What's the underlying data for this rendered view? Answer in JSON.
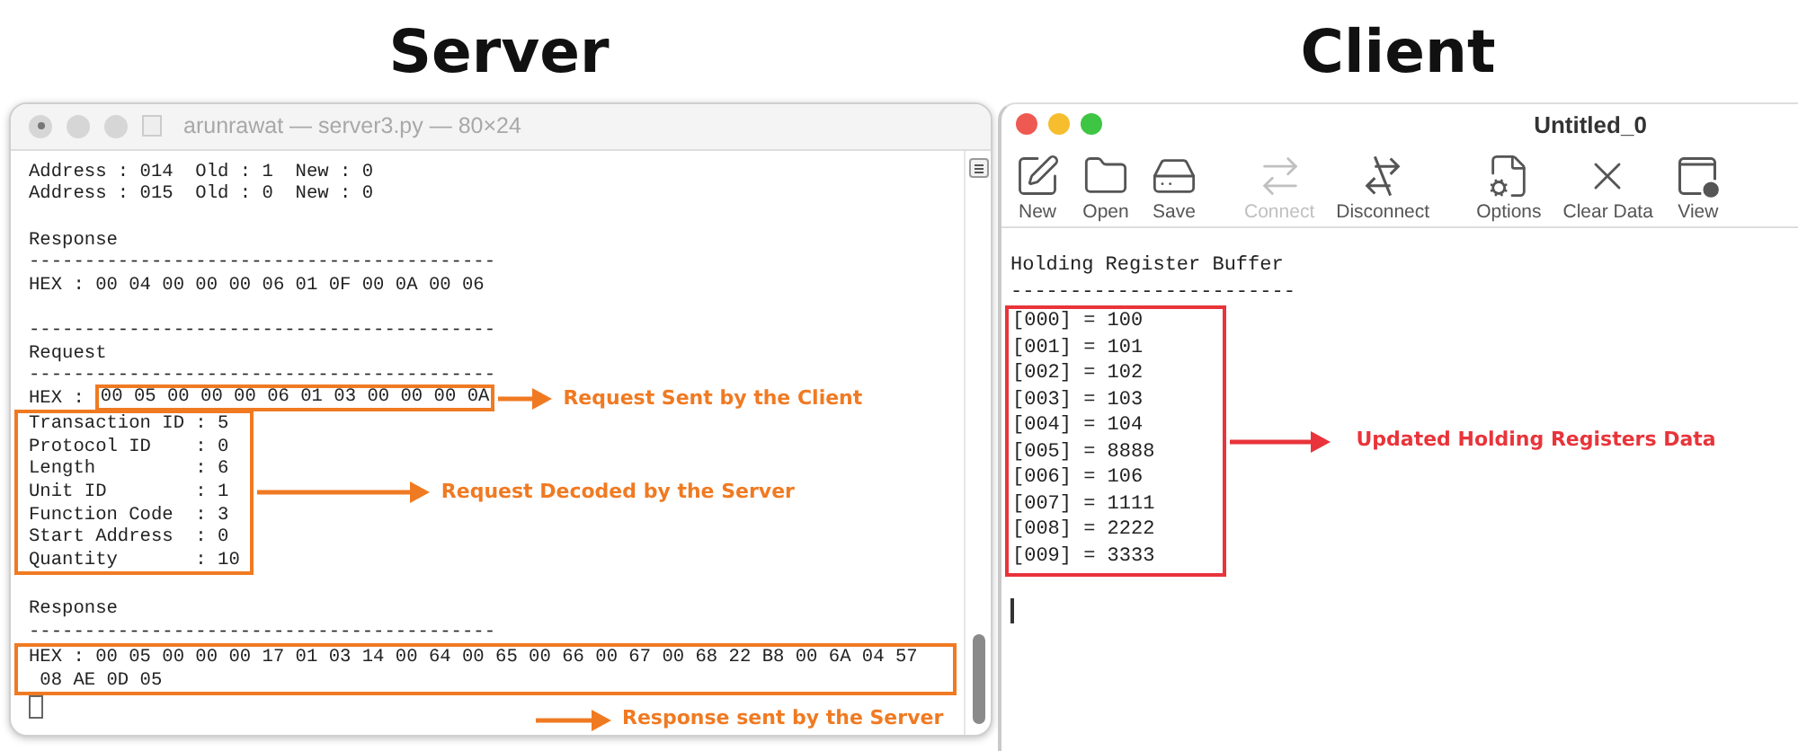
{
  "headings": [
    "Server",
    "Client"
  ],
  "server": {
    "title": "arunrawat — server3.py — 80×24",
    "blocks": [
      {
        "kind": "text",
        "lines": [
          "Address : 014  Old : 1  New : 0",
          "Address : 015  Old : 0  New : 0"
        ]
      },
      {
        "kind": "gap"
      },
      {
        "kind": "text",
        "lines": [
          "Response",
          "------------------------------------------",
          "HEX : 00 04 00 00 00 06 01 0F 00 0A 00 06"
        ]
      },
      {
        "kind": "gap"
      },
      {
        "kind": "text",
        "lines": [
          "------------------------------------------",
          "Request",
          "------------------------------------------"
        ]
      },
      {
        "kind": "inline-box",
        "prefix": "HEX :",
        "boxed": "00 05 00 00 00 06 01 03 00 00 00 0A",
        "note": "Request Sent by the Client"
      },
      {
        "kind": "box",
        "lines": [
          "Transaction ID : 5",
          "Protocol ID    : 0",
          "Length         : 6",
          "Unit ID        : 1",
          "Function Code  : 3",
          "Start Address  : 0",
          "Quantity       : 10"
        ],
        "note": "Request Decoded by the Server"
      },
      {
        "kind": "gap"
      },
      {
        "kind": "text",
        "lines": [
          "Response",
          "------------------------------------------"
        ]
      },
      {
        "kind": "wide-box",
        "lines": [
          "HEX : 00 05 00 00 00 17 01 03 14 00 64 00 65 00 66 00 67 00 68 22 B8 00 6A 04 57",
          " 08 AE 0D 05"
        ]
      },
      {
        "kind": "cursor"
      },
      {
        "kind": "note",
        "text": "Response sent by the Server"
      }
    ]
  },
  "client": {
    "title": "Untitled_0",
    "toolbar": [
      {
        "label": "New",
        "disabled": false
      },
      {
        "label": "Open",
        "disabled": false
      },
      {
        "label": "Save",
        "disabled": false
      },
      {
        "label": "Connect",
        "disabled": true
      },
      {
        "label": "Disconnect",
        "disabled": false
      },
      {
        "label": "Options",
        "disabled": false
      },
      {
        "label": "Clear Data",
        "disabled": false
      },
      {
        "label": "View",
        "disabled": false
      }
    ],
    "heading": "Holding Register Buffer",
    "rule": "------------------------",
    "registers": [
      "[000] = 100",
      "[001] = 101",
      "[002] = 102",
      "[003] = 103",
      "[004] = 104",
      "[005] = 8888",
      "[006] = 106",
      "[007] = 1111",
      "[008] = 2222",
      "[009] = 3333"
    ],
    "note": "Updated Holding Registers Data"
  }
}
